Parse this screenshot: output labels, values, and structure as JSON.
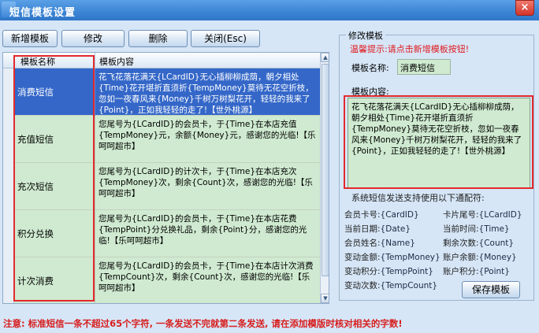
{
  "window": {
    "title": "短信模板设置",
    "close_glyph": "×"
  },
  "toolbar": {
    "add_label": "新增模板",
    "edit_label": "修改",
    "delete_label": "删除",
    "close_label": "关闭(Esc)"
  },
  "grid": {
    "columns": [
      "模板名称",
      "模板内容"
    ],
    "rows": [
      {
        "name": "消费短信",
        "content": "花飞花落花满天{LCardID}无心插柳柳成荫，朝夕相处{Time}花开堪折直须折{TempMoney}莫待无花空折枝，忽如一夜春风来{Money}千树万树梨花开，轻轻的我来了{Point}，正如我轻轻的走了!【世外桃源】"
      },
      {
        "name": "充值短信",
        "content": "您尾号为{LCardID}的会员卡，于{Time}在本店充值{TempMoney}元，余额{Money}元，感谢您的光临!【乐呵呵超市】"
      },
      {
        "name": "充次短信",
        "content": "您尾号为{LCardID}的计次卡，于{Time}在本店充次{TempMoney}次，剩余{Count}次，感谢您的光临!【乐呵呵超市】"
      },
      {
        "name": "积分兑换",
        "content": "您尾号为{LCardID}的会员卡，于{Time}在本店花费{TempPoint}分兑换礼品，剩余{Point}分，感谢您的光临!【乐呵呵超市】"
      },
      {
        "name": "计次消费",
        "content": "您尾号为{LCardID}的会员卡，于{Time}在本店计次消费{TempCount}次，剩余{Count}次，感谢您的光临!【乐呵呵超市】"
      }
    ]
  },
  "panel": {
    "legend": "修改模板",
    "hint": "温馨提示:请点击新增模板按钮!",
    "name_label": "模板名称:",
    "name_value": "消费短信",
    "content_label": "模板内容:",
    "content_value": "花飞花落花满天{LCardID}无心插柳柳成荫，朝夕相处{Time}花开堪折直须折{TempMoney}莫待无花空折枝，忽如一夜春风来{Money}千树万树梨花开，轻轻的我来了{Point}，正如我轻轻的走了!【世外桃源】",
    "support_text": "系统短信发送支持使用以下通配符:",
    "codes": [
      {
        "k": "会员卡号:",
        "v": "{CardID}"
      },
      {
        "k": "卡片尾号:",
        "v": "{LCardID}"
      },
      {
        "k": "当前日期:",
        "v": "{Date}"
      },
      {
        "k": "当前时间:",
        "v": "{Time}"
      },
      {
        "k": "会员姓名:",
        "v": "{Name}"
      },
      {
        "k": "剩余次数:",
        "v": "{Count}"
      },
      {
        "k": "变动金额:",
        "v": "{TempMoney}"
      },
      {
        "k": "账户余额:",
        "v": "{Money}"
      },
      {
        "k": "变动积分:",
        "v": "{TempPoint}"
      },
      {
        "k": "账户积分:",
        "v": "{Point}"
      },
      {
        "k": "变动次数:",
        "v": "{TempCount}"
      }
    ],
    "save_label": "保存模板"
  },
  "notice": "注意: 标准短信一条不超过65个字符, 一条发送不完就第二条发送, 请在添加模版时核对相关的字数!"
}
